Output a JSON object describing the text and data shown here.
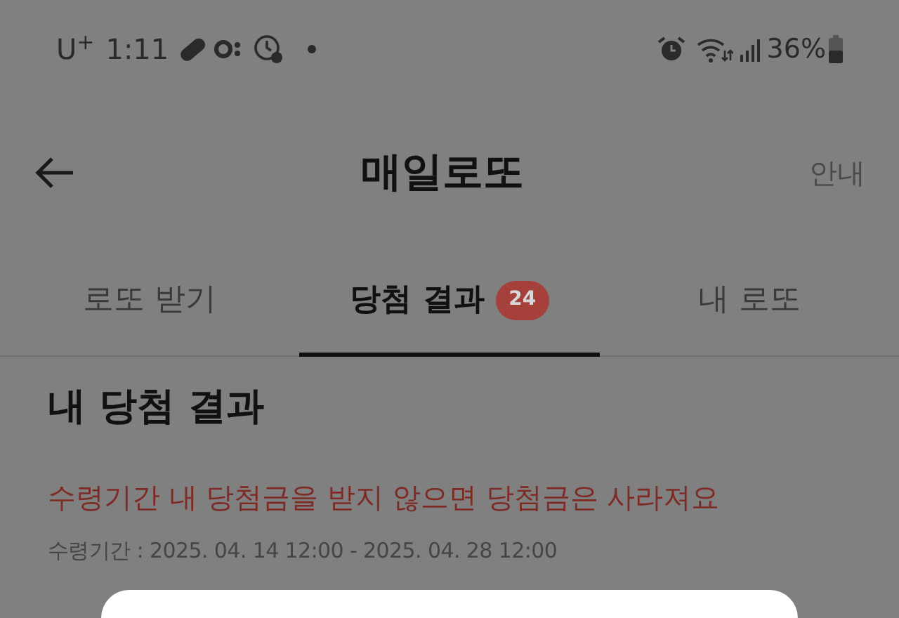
{
  "status_bar": {
    "carrier": "U$^{+}$",
    "time": "1:11",
    "battery": "36%"
  },
  "header": {
    "title": "매일로또",
    "action": "안내"
  },
  "tabs": [
    {
      "label": "로또 받기",
      "selected": false
    },
    {
      "label": "당첨 결과",
      "selected": true,
      "badge": "24"
    },
    {
      "label": "내 로또",
      "selected": false
    }
  ],
  "section": {
    "title": "내 당첨 결과",
    "warning": "수령기간 내 당첨금을 받지 않으면 당첨금은 사라져요",
    "period": "수령기간 : 2025. 04. 14 12:00 - 2025. 04. 28 12:00"
  },
  "sheet": {
    "kind": "dialog"
  }
}
